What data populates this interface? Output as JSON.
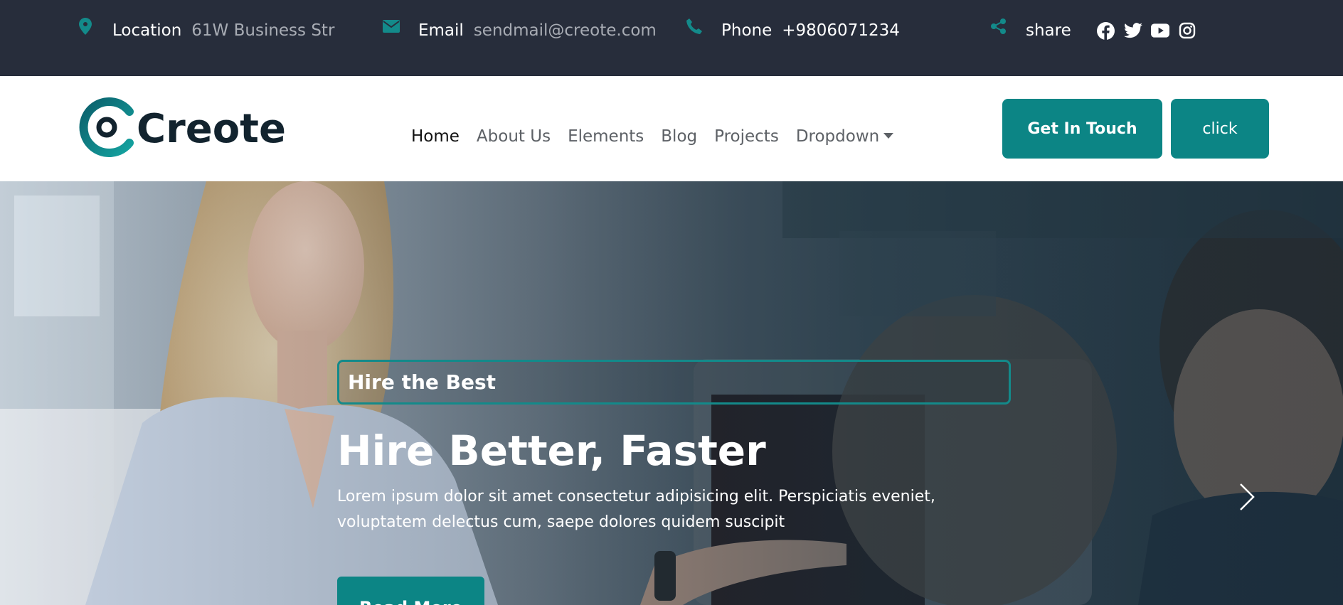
{
  "topbar": {
    "location": {
      "label": "Location",
      "value": "61W Business Str",
      "icon": "map-pin-icon"
    },
    "email": {
      "label": "Email",
      "value": "sendmail@creote.com",
      "icon": "envelope-icon"
    },
    "phone": {
      "label": "Phone",
      "value": "+9806071234",
      "icon": "phone-icon"
    },
    "share": {
      "label": "share",
      "icon": "share-icon",
      "socials": [
        "facebook-icon",
        "twitter-icon",
        "youtube-icon",
        "instagram-icon"
      ]
    },
    "colors": {
      "background": "#272d3b",
      "accent": "#138a8a",
      "muted_text": "#a8acb4"
    }
  },
  "header": {
    "logo_text": "Creote",
    "nav": [
      {
        "label": "Home",
        "active": true
      },
      {
        "label": "About Us"
      },
      {
        "label": "Elements"
      },
      {
        "label": "Blog"
      },
      {
        "label": "Projects"
      },
      {
        "label": "Dropdown",
        "has_caret": true
      }
    ],
    "buttons": {
      "get_in_touch": "Get In Touch",
      "click": "click"
    },
    "colors": {
      "brand": "#0c8585",
      "logo_text": "#12232e"
    }
  },
  "hero": {
    "badge": "Hire the Best",
    "title": "Hire Better, Faster",
    "text": "Lorem ipsum dolor sit amet consectetur adipisicing elit. Perspiciatis eveniet, voluptatem delectus cum, saepe dolores quidem suscipit",
    "button": "Read More",
    "prev_icon": "chevron-left-icon",
    "next_icon": "chevron-right-icon"
  }
}
